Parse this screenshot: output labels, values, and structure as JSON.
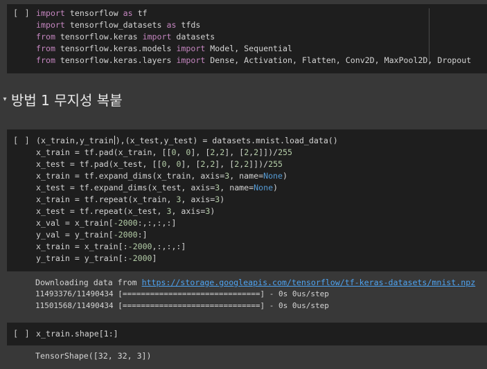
{
  "cell1": {
    "run_label": "[ ]",
    "lines": [
      {
        "kw1": "import",
        "rest": " tensorflow ",
        "kw2": "as",
        "tail": " tf"
      },
      {
        "kw1": "import",
        "rest": " tensorflow_datasets ",
        "kw2": "as",
        "tail": " tfds"
      },
      {
        "kw1": "from",
        "rest": " tensorflow.keras ",
        "kw2": "import",
        "tail": " datasets"
      },
      {
        "kw1": "from",
        "rest": " tensorflow.keras.models ",
        "kw2": "import",
        "tail": " Model, Sequential"
      },
      {
        "kw1": "from",
        "rest": " tensorflow.keras.layers ",
        "kw2": "import",
        "tail": " Dense, Activation, Flatten, Conv2D, MaxPool2D, Dropout"
      }
    ]
  },
  "section": {
    "title": "방법 1 무지성 복붙"
  },
  "cell2": {
    "run_label": "[ ]",
    "line1_a": "(x_train,y_train",
    "line1_b": "),(x_test,y_test) = datasets.mnist.load_data()",
    "line2_a": "x_train = tf.pad(x_train, [[",
    "line2_n1": "0",
    "line2_b": ", ",
    "line2_n2": "0",
    "line2_c": "], [",
    "line2_n3": "2",
    "line2_d": ",",
    "line2_n4": "2",
    "line2_e": "], [",
    "line2_n5": "2",
    "line2_f": ",",
    "line2_n6": "2",
    "line2_g": "]])/",
    "line2_n7": "255",
    "line3_a": "x_test = tf.pad(x_test, [[",
    "line3_n1": "0",
    "line3_b": ", ",
    "line3_n2": "0",
    "line3_c": "], [",
    "line3_n3": "2",
    "line3_d": ",",
    "line3_n4": "2",
    "line3_e": "], [",
    "line3_n5": "2",
    "line3_f": ",",
    "line3_n6": "2",
    "line3_g": "]])/",
    "line3_n7": "255",
    "line4_a": "x_train = tf.expand_dims(x_train, axis=",
    "line4_n": "3",
    "line4_b": ", name=",
    "line4_none": "None",
    "line4_c": ")",
    "line5_a": "x_test = tf.expand_dims(x_test, axis=",
    "line5_n": "3",
    "line5_b": ", name=",
    "line5_none": "None",
    "line5_c": ")",
    "line6_a": "x_train = tf.repeat(x_train, ",
    "line6_n1": "3",
    "line6_b": ", axis=",
    "line6_n2": "3",
    "line6_c": ")",
    "line7_a": "x_test = tf.repeat(x_test, ",
    "line7_n1": "3",
    "line7_b": ", axis=",
    "line7_n2": "3",
    "line7_c": ")",
    "line8_a": "x_val = x_train[",
    "line8_n": "-2000",
    "line8_b": ":,:,:,:]",
    "line9_a": "y_val = y_train[",
    "line9_n": "-2000",
    "line9_b": ":]",
    "line10_a": "x_train = x_train[:",
    "line10_n": "-2000",
    "line10_b": ",:,:,:]",
    "line11_a": "y_train = y_train[:",
    "line11_n": "-2000",
    "line11_b": "]"
  },
  "output2": {
    "download_prefix": "Downloading data from ",
    "download_url": "https://storage.googleapis.com/tensorflow/tf-keras-datasets/mnist.npz",
    "progress1": "11493376/11490434 [==============================] - 0s 0us/step",
    "progress2": "11501568/11490434 [==============================] - 0s 0us/step"
  },
  "cell3": {
    "run_label": "[ ]",
    "code": "x_train.shape[1:]"
  },
  "output3": {
    "text": "TensorShape([32, 32, 3])"
  }
}
